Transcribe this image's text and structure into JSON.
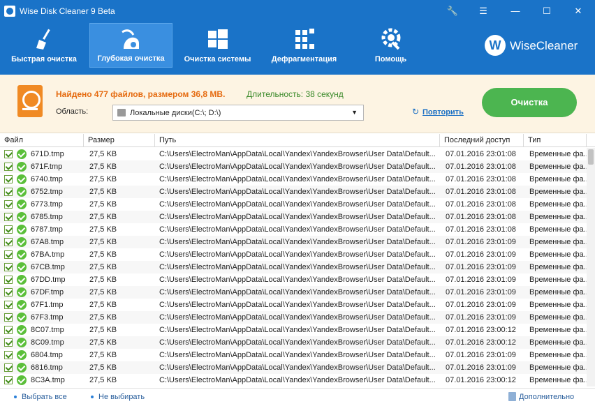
{
  "window": {
    "title": "Wise Disk Cleaner 9 Beta",
    "controls": [
      "🔧",
      "☰",
      "—",
      "☐",
      "✕"
    ]
  },
  "toolbar": {
    "tabs": [
      {
        "label": "Быстрая очистка",
        "icon": "broom-icon",
        "active": false
      },
      {
        "label": "Глубокая очистка",
        "icon": "vacuum-icon",
        "active": true
      },
      {
        "label": "Очистка системы",
        "icon": "windows-icon",
        "active": false
      },
      {
        "label": "Дефрагментация",
        "icon": "defrag-icon",
        "active": false
      },
      {
        "label": "Помощь",
        "icon": "gear-wrench-icon",
        "active": false
      }
    ],
    "brand_logo": "W",
    "brand_name": "WiseCleaner"
  },
  "summary": {
    "found": "Найдено 477 файлов, размером 36,8 MB.",
    "duration": "Длительность: 38 секунд",
    "area_label": "Область:",
    "area_value": "Локальные диски(C:\\; D:\\)",
    "repeat": "Повторить",
    "clean_button": "Очистка"
  },
  "table": {
    "columns": [
      "Файл",
      "Размер",
      "Путь",
      "Последний доступ",
      "Тип"
    ],
    "rows": [
      {
        "file": "671D.tmp",
        "size": "27,5 KB",
        "path": "C:\\Users\\ElectroMan\\AppData\\Local\\Yandex\\YandexBrowser\\User Data\\Default...",
        "accessed": "07.01.2016 23:01:08",
        "type": "Временные фа..."
      },
      {
        "file": "671F.tmp",
        "size": "27,5 KB",
        "path": "C:\\Users\\ElectroMan\\AppData\\Local\\Yandex\\YandexBrowser\\User Data\\Default...",
        "accessed": "07.01.2016 23:01:08",
        "type": "Временные фа..."
      },
      {
        "file": "6740.tmp",
        "size": "27,5 KB",
        "path": "C:\\Users\\ElectroMan\\AppData\\Local\\Yandex\\YandexBrowser\\User Data\\Default...",
        "accessed": "07.01.2016 23:01:08",
        "type": "Временные фа..."
      },
      {
        "file": "6752.tmp",
        "size": "27,5 KB",
        "path": "C:\\Users\\ElectroMan\\AppData\\Local\\Yandex\\YandexBrowser\\User Data\\Default...",
        "accessed": "07.01.2016 23:01:08",
        "type": "Временные фа..."
      },
      {
        "file": "6773.tmp",
        "size": "27,5 KB",
        "path": "C:\\Users\\ElectroMan\\AppData\\Local\\Yandex\\YandexBrowser\\User Data\\Default...",
        "accessed": "07.01.2016 23:01:08",
        "type": "Временные фа..."
      },
      {
        "file": "6785.tmp",
        "size": "27,5 KB",
        "path": "C:\\Users\\ElectroMan\\AppData\\Local\\Yandex\\YandexBrowser\\User Data\\Default...",
        "accessed": "07.01.2016 23:01:08",
        "type": "Временные фа..."
      },
      {
        "file": "6787.tmp",
        "size": "27,5 KB",
        "path": "C:\\Users\\ElectroMan\\AppData\\Local\\Yandex\\YandexBrowser\\User Data\\Default...",
        "accessed": "07.01.2016 23:01:08",
        "type": "Временные фа..."
      },
      {
        "file": "67A8.tmp",
        "size": "27,5 KB",
        "path": "C:\\Users\\ElectroMan\\AppData\\Local\\Yandex\\YandexBrowser\\User Data\\Default...",
        "accessed": "07.01.2016 23:01:09",
        "type": "Временные фа..."
      },
      {
        "file": "67BA.tmp",
        "size": "27,5 KB",
        "path": "C:\\Users\\ElectroMan\\AppData\\Local\\Yandex\\YandexBrowser\\User Data\\Default...",
        "accessed": "07.01.2016 23:01:09",
        "type": "Временные фа..."
      },
      {
        "file": "67CB.tmp",
        "size": "27,5 KB",
        "path": "C:\\Users\\ElectroMan\\AppData\\Local\\Yandex\\YandexBrowser\\User Data\\Default...",
        "accessed": "07.01.2016 23:01:09",
        "type": "Временные фа..."
      },
      {
        "file": "67DD.tmp",
        "size": "27,5 KB",
        "path": "C:\\Users\\ElectroMan\\AppData\\Local\\Yandex\\YandexBrowser\\User Data\\Default...",
        "accessed": "07.01.2016 23:01:09",
        "type": "Временные фа..."
      },
      {
        "file": "67DF.tmp",
        "size": "27,5 KB",
        "path": "C:\\Users\\ElectroMan\\AppData\\Local\\Yandex\\YandexBrowser\\User Data\\Default...",
        "accessed": "07.01.2016 23:01:09",
        "type": "Временные фа..."
      },
      {
        "file": "67F1.tmp",
        "size": "27,5 KB",
        "path": "C:\\Users\\ElectroMan\\AppData\\Local\\Yandex\\YandexBrowser\\User Data\\Default...",
        "accessed": "07.01.2016 23:01:09",
        "type": "Временные фа..."
      },
      {
        "file": "67F3.tmp",
        "size": "27,5 KB",
        "path": "C:\\Users\\ElectroMan\\AppData\\Local\\Yandex\\YandexBrowser\\User Data\\Default...",
        "accessed": "07.01.2016 23:01:09",
        "type": "Временные фа..."
      },
      {
        "file": "8C07.tmp",
        "size": "27,5 KB",
        "path": "C:\\Users\\ElectroMan\\AppData\\Local\\Yandex\\YandexBrowser\\User Data\\Default...",
        "accessed": "07.01.2016 23:00:12",
        "type": "Временные фа..."
      },
      {
        "file": "8C09.tmp",
        "size": "27,5 KB",
        "path": "C:\\Users\\ElectroMan\\AppData\\Local\\Yandex\\YandexBrowser\\User Data\\Default...",
        "accessed": "07.01.2016 23:00:12",
        "type": "Временные фа..."
      },
      {
        "file": "6804.tmp",
        "size": "27,5 KB",
        "path": "C:\\Users\\ElectroMan\\AppData\\Local\\Yandex\\YandexBrowser\\User Data\\Default...",
        "accessed": "07.01.2016 23:01:09",
        "type": "Временные фа..."
      },
      {
        "file": "6816.tmp",
        "size": "27,5 KB",
        "path": "C:\\Users\\ElectroMan\\AppData\\Local\\Yandex\\YandexBrowser\\User Data\\Default...",
        "accessed": "07.01.2016 23:01:09",
        "type": "Временные фа..."
      },
      {
        "file": "8C3A.tmp",
        "size": "27,5 KB",
        "path": "C:\\Users\\ElectroMan\\AppData\\Local\\Yandex\\YandexBrowser\\User Data\\Default...",
        "accessed": "07.01.2016 23:00:12",
        "type": "Временные фа..."
      }
    ]
  },
  "footer": {
    "select_all": "Выбрать все",
    "select_none": "Не выбирать",
    "advanced": "Дополнительно"
  },
  "colors": {
    "toolbar_bg": "#1a73c8",
    "summary_bg": "#fdf4e3",
    "found_text": "#e56a0f",
    "duration_text": "#3b8a2a",
    "clean_button": "#4cb550"
  }
}
